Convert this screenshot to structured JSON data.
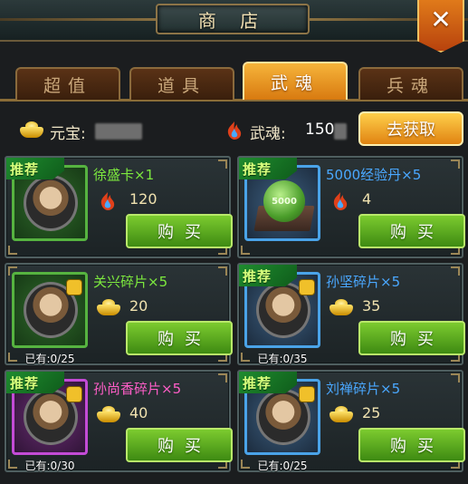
{
  "header": {
    "title": "商 店",
    "close_label": "✕"
  },
  "tabs": [
    {
      "label": "超值",
      "active": false
    },
    {
      "label": "道具",
      "active": false
    },
    {
      "label": "武魂",
      "active": true
    },
    {
      "label": "兵魂",
      "active": false
    }
  ],
  "currency": {
    "ingot_label": "元宝:",
    "soul_label": "武魂:",
    "soul_value": "150",
    "get_button": "去获取"
  },
  "colors": {
    "accent_orange": "#e08312",
    "buy_green": "#5aa81f",
    "name_green": "#7dea3e",
    "name_blue": "#4aa8ff",
    "name_pink": "#ff5ec8"
  },
  "items": [
    {
      "name": "徐盛卡×1",
      "price": "120",
      "currency": "soul-icon",
      "recommended": "推荐",
      "owned": "",
      "buy": "购买",
      "name_color": "green",
      "frame": "green"
    },
    {
      "name": "5000经验丹×5",
      "price": "4",
      "currency": "soul-icon",
      "recommended": "推荐",
      "owned": "",
      "buy": "购买",
      "name_color": "blue",
      "frame": "blue",
      "pill_text": "5000"
    },
    {
      "name": "关兴碎片×5",
      "price": "20",
      "currency": "ingot-icon",
      "recommended": "",
      "owned": "已有:0/25",
      "buy": "购买",
      "name_color": "green",
      "frame": "green"
    },
    {
      "name": "孙坚碎片×5",
      "price": "35",
      "currency": "ingot-icon",
      "recommended": "推荐",
      "owned": "已有:0/35",
      "buy": "购买",
      "name_color": "blue",
      "frame": "blue"
    },
    {
      "name": "孙尚香碎片×5",
      "price": "40",
      "currency": "ingot-icon",
      "recommended": "推荐",
      "owned": "已有:0/30",
      "buy": "购买",
      "name_color": "pink",
      "frame": "purple"
    },
    {
      "name": "刘禅碎片×5",
      "price": "25",
      "currency": "ingot-icon",
      "recommended": "推荐",
      "owned": "已有:0/25",
      "buy": "购买",
      "name_color": "blue",
      "frame": "blue"
    }
  ]
}
